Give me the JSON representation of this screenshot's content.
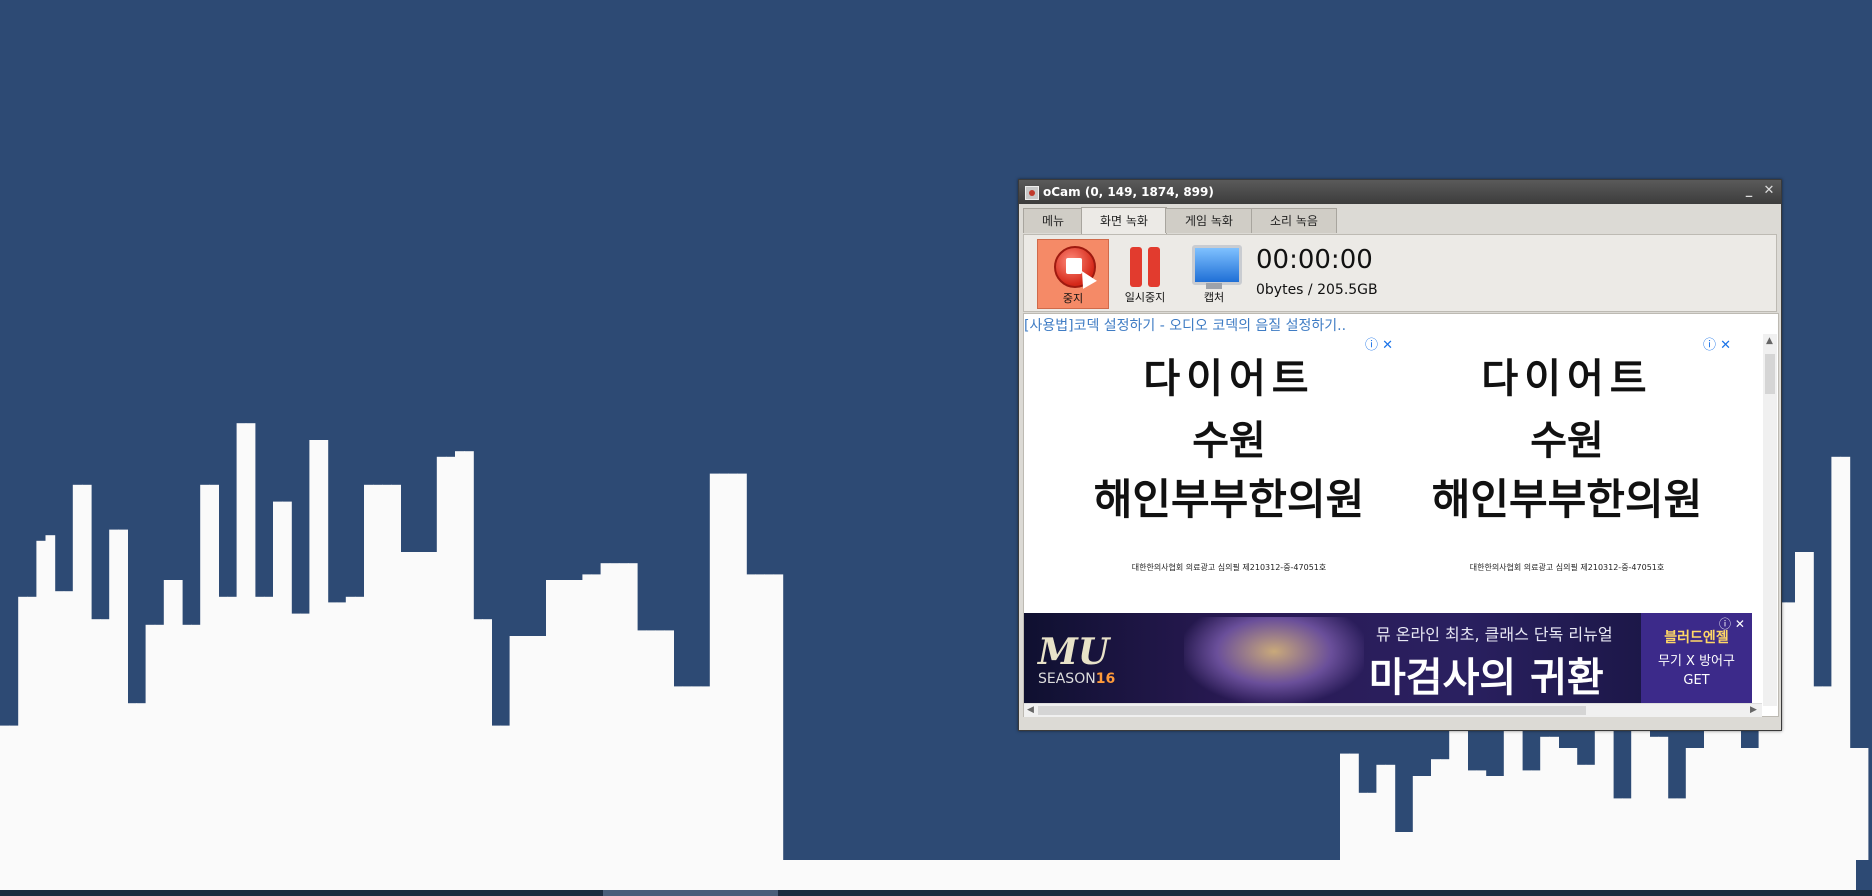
{
  "colors": {
    "background": "#2d4a74",
    "bars": "#fafafa"
  },
  "spectrum": {
    "levels": [
      24,
      24,
      47,
      47,
      57,
      58,
      48,
      48,
      67,
      67,
      43,
      43,
      59,
      59,
      28,
      28,
      42,
      42,
      50,
      50,
      42,
      42,
      67,
      67,
      47,
      47,
      78,
      78,
      47,
      47,
      64,
      64,
      44,
      44,
      75,
      75,
      46,
      46,
      47,
      47,
      67,
      67,
      67,
      67,
      55,
      55,
      55,
      55,
      72,
      72,
      73,
      73,
      43,
      43,
      24,
      24,
      40,
      40,
      40,
      40,
      50,
      50,
      50,
      50,
      51,
      51,
      53,
      53,
      53,
      53,
      41,
      41,
      41,
      41,
      31,
      31,
      31,
      31,
      69,
      69,
      69,
      69,
      51,
      51,
      51,
      51
    ],
    "levels_right": [
      19,
      19,
      12,
      12,
      17,
      17,
      5,
      5,
      15,
      15,
      18,
      18,
      24,
      24,
      16,
      16,
      15,
      15,
      24,
      24,
      16,
      16,
      22,
      22,
      20,
      20,
      17,
      17,
      25,
      25,
      11,
      11,
      32,
      32,
      22,
      22,
      11,
      11,
      20,
      20,
      60,
      60,
      30,
      30,
      20,
      20,
      36,
      36,
      46,
      46,
      55,
      55,
      31,
      31,
      72,
      72,
      20,
      20
    ]
  },
  "window": {
    "title": "oCam (0, 149, 1874, 899)",
    "minimize": "_",
    "close": "✕",
    "tabs": [
      "메뉴",
      "화면 녹화",
      "게임 녹화",
      "소리 녹음"
    ],
    "active_tab": "화면 녹화",
    "toolbar": {
      "stop_label": "중지",
      "pause_label": "일시중지",
      "capture_label": "캡처",
      "timer": "00:00:00",
      "size": "0bytes / 205.5GB"
    },
    "content": {
      "link": "[사용법]코덱 설정하기 - 오디오 코덱의 음질 설정하기..",
      "ads": [
        {
          "line1": "다이어트",
          "line2": "수원",
          "line3": "해인부부한의원",
          "small": "대한한의사협회 의료광고 심의필 제210312-중-47051호",
          "x_icon": "ⓘ ✕"
        },
        {
          "line1": "다이어트",
          "line2": "수원",
          "line3": "해인부부한의원",
          "small": "대한한의사협회 의료광고 심의필 제210312-중-47051호",
          "x_icon": "ⓘ ✕"
        }
      ],
      "banner": {
        "logo": "MU",
        "season": "SEASON",
        "season_num": "16",
        "sub": "뮤 온라인 최초, 클래스 단독 리뉴얼",
        "main": "마검사의 귀환",
        "side1": "블러드엔젤",
        "side2": "무기 X 방어구",
        "side3": "GET",
        "x_icon": "ⓘ ✕"
      }
    }
  }
}
